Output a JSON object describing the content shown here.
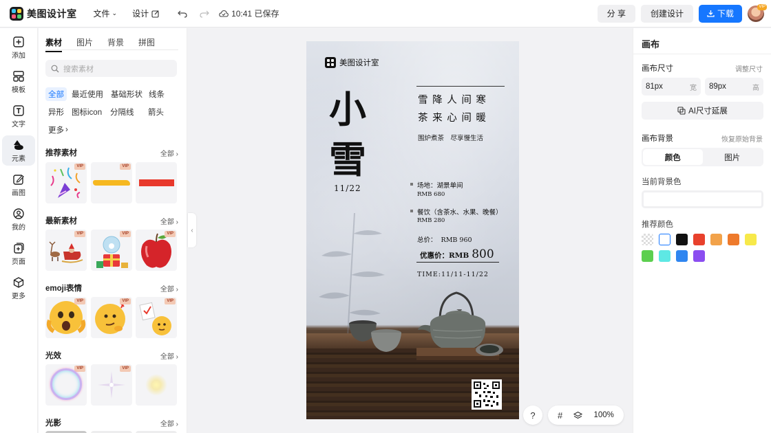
{
  "app": {
    "name": "美图设计室"
  },
  "topbar": {
    "file_label": "文件",
    "design_label": "设计",
    "saved_text": "10:41 已保存",
    "share_label": "分 享",
    "create_label": "创建设计",
    "download_label": "下载",
    "avatar_badge": "VIP"
  },
  "rail": {
    "items": [
      {
        "label": "添加",
        "icon": "plus-square-icon"
      },
      {
        "label": "模板",
        "icon": "template-icon"
      },
      {
        "label": "文字",
        "icon": "text-icon"
      },
      {
        "label": "元素",
        "icon": "shapes-icon"
      },
      {
        "label": "画图",
        "icon": "draw-icon"
      },
      {
        "label": "我的",
        "icon": "user-icon"
      },
      {
        "label": "页面",
        "icon": "page-add-icon"
      },
      {
        "label": "更多",
        "icon": "cube-icon"
      }
    ]
  },
  "panel": {
    "tabs": [
      "素材",
      "图片",
      "背景",
      "拼图"
    ],
    "search_placeholder": "搜索素材",
    "chips": [
      "全部",
      "最近使用",
      "基础形状",
      "线条",
      "异形",
      "图标icon",
      "分隔线",
      "箭头",
      "更多"
    ],
    "sections": [
      {
        "title": "推荐素材",
        "all": "全部"
      },
      {
        "title": "最新素材",
        "all": "全部"
      },
      {
        "title": "emoji表情",
        "all": "全部"
      },
      {
        "title": "光效",
        "all": "全部"
      },
      {
        "title": "光影",
        "all": "全部"
      }
    ],
    "vip": "VIP"
  },
  "poster": {
    "brand": "美图设计室",
    "title_1": "小",
    "title_2": "雪",
    "date": "11/22",
    "line_1": "雪 降 人 间 寒",
    "line_2": "茶 来 心 间 暖",
    "sub": "围炉煮茶　尽享慢生活",
    "venue": "场地：湖景单间",
    "venue_price": "RMB 680",
    "food": "餐饮（含茶水、水果、晚餐）",
    "food_price": "RMB 280",
    "total": "总价：  RMB 960",
    "promo_label": "优惠价：RMB",
    "promo_value": "800",
    "time": "TIME:11/11-11/22"
  },
  "canvas_tools": {
    "help": "?",
    "zoom": "100%"
  },
  "right": {
    "title": "画布",
    "size_label": "画布尺寸",
    "adjust_label": "调整尺寸",
    "width_value": "81px",
    "width_unit": "宽",
    "height_value": "89px",
    "height_unit": "高",
    "ai_expand": "AI尺寸延展",
    "bg_label": "画布背景",
    "restore_label": "恢复原始背景",
    "seg_color": "颜色",
    "seg_image": "图片",
    "current_bg": "当前背景色",
    "recommend": "推荐颜色",
    "colors": [
      "transparent",
      "#ffffff",
      "#111111",
      "#e8412c",
      "#f2a24a",
      "#ee7a2c",
      "#f7e94a",
      "#5ccf4f",
      "#5ee8e4",
      "#2f86f0",
      "#8b4ef0"
    ]
  }
}
